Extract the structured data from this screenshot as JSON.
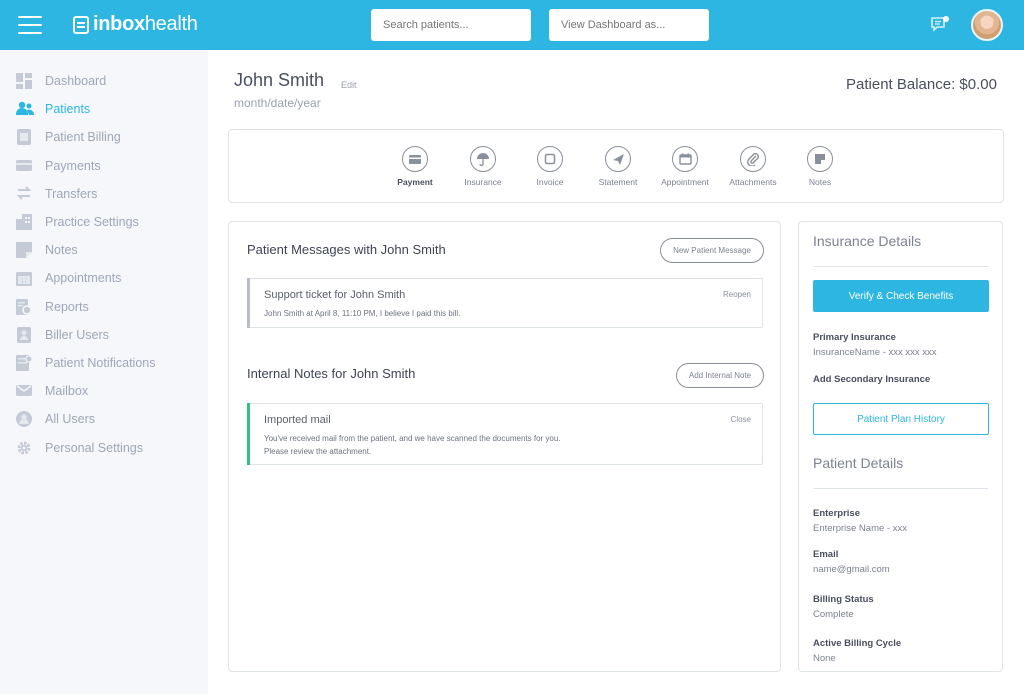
{
  "app": {
    "logo_prefix": "inbox",
    "logo_suffix": "health",
    "brand_color": "#2eb6e2"
  },
  "topbar": {
    "search_placeholder": "Search patients...",
    "dashboard_placeholder": "View Dashboard as..."
  },
  "sidebar": {
    "items": [
      {
        "label": "Dashboard",
        "icon": "dashboard-icon",
        "active": false
      },
      {
        "label": "Patients",
        "icon": "patients-icon",
        "active": true
      },
      {
        "label": "Patient Billing",
        "icon": "billing-icon",
        "active": false
      },
      {
        "label": "Payments",
        "icon": "card-icon",
        "active": false
      },
      {
        "label": "Transfers",
        "icon": "transfer-icon",
        "active": false
      },
      {
        "label": "Practice Settings",
        "icon": "building-icon",
        "active": false
      },
      {
        "label": "Notes",
        "icon": "note-icon",
        "active": false
      },
      {
        "label": "Appointments",
        "icon": "calendar-icon",
        "active": false
      },
      {
        "label": "Reports",
        "icon": "report-icon",
        "active": false
      },
      {
        "label": "Biller Users",
        "icon": "biller-icon",
        "active": false
      },
      {
        "label": "Patient Notifications",
        "icon": "notification-icon",
        "active": false
      },
      {
        "label": "Mailbox",
        "icon": "mailbox-icon",
        "active": false
      },
      {
        "label": "All Users",
        "icon": "users-icon",
        "active": false
      },
      {
        "label": "Personal Settings",
        "icon": "gear-icon",
        "active": false
      }
    ]
  },
  "patient": {
    "name": "John Smith",
    "edit_label": "Edit",
    "dob": "month/date/year",
    "balance": "Patient Balance: $0.00"
  },
  "actions": [
    {
      "label": "Payment",
      "icon": "payment-icon"
    },
    {
      "label": "Insurance",
      "icon": "umbrella-icon"
    },
    {
      "label": "Invoice",
      "icon": "invoice-icon"
    },
    {
      "label": "Statement",
      "icon": "send-icon"
    },
    {
      "label": "Appointment",
      "icon": "calendar-icon"
    },
    {
      "label": "Attachments",
      "icon": "paperclip-icon"
    },
    {
      "label": "Notes",
      "icon": "note-icon"
    }
  ],
  "messages": {
    "title": "Patient Messages with John Smith",
    "new_button": "New Patient Message",
    "ticket_title": "Support ticket for John Smith",
    "ticket_body": "John Smith at April 8, 11:10 PM, I believe I paid this bill.",
    "ticket_action": "Reopen"
  },
  "notes": {
    "title": "Internal Notes for John Smith",
    "add_button": "Add Internal Note",
    "note_title": "Imported mail",
    "note_body_1": "You've received mail from the patient, and we have scanned the documents for you.",
    "note_body_2": "Please review the attachment.",
    "note_action": "Close"
  },
  "insurance": {
    "title": "Insurance Details",
    "verify_button": "Verify & Check Benefits",
    "primary_label": "Primary Insurance",
    "primary_value": "InsuranceName - xxx xxx xxx",
    "secondary_label": "Add Secondary Insurance",
    "plan_button": "Patient Plan History"
  },
  "details": {
    "title": "Patient Details",
    "enterprise_label": "Enterprise",
    "enterprise_value": "Enterprise Name - xxx",
    "email_label": "Email",
    "email_value": "name@gmail.com",
    "billing_status_label": "Billing Status",
    "billing_status_value": "Complete",
    "billing_cycle_label": "Active Billing Cycle",
    "billing_cycle_value": "None"
  }
}
